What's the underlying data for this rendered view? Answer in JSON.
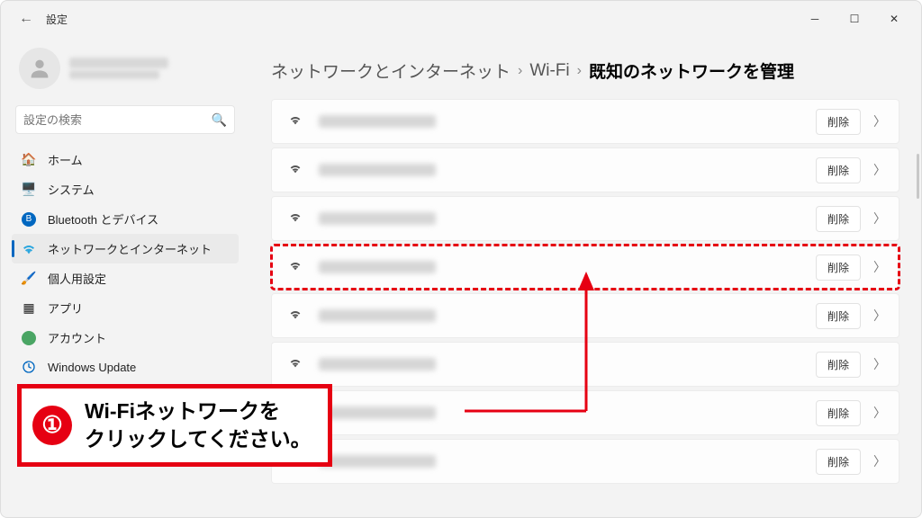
{
  "window": {
    "app_title": "設定",
    "back": "←"
  },
  "user": {
    "name_blur": true,
    "email_blur": true
  },
  "search": {
    "placeholder": "設定の検索"
  },
  "sidebar": {
    "items": [
      {
        "icon_color": "#c76b1e",
        "label": "ホーム",
        "name": "home"
      },
      {
        "icon_color": "#0067c0",
        "label": "システム",
        "name": "system"
      },
      {
        "icon_color": "#0067c0",
        "label": "Bluetooth とデバイス",
        "name": "bluetooth"
      },
      {
        "icon_color": "#0067c0",
        "label": "ネットワークとインターネット",
        "name": "network",
        "active": true
      },
      {
        "icon_color": "#b85c00",
        "label": "個人用設定",
        "name": "personalization"
      },
      {
        "icon_color": "#2b7cd3",
        "label": "アプリ",
        "name": "apps"
      },
      {
        "icon_color": "#4aa564",
        "label": "アカウント",
        "name": "account"
      },
      {
        "icon_color": "#888",
        "label": "",
        "name": "hidden1",
        "hidden_by_callout": true
      },
      {
        "icon_color": "#888",
        "label": "",
        "name": "hidden2",
        "hidden_by_callout": true
      },
      {
        "icon_color": "#888",
        "label": "",
        "name": "hidden3",
        "hidden_by_callout": true
      },
      {
        "icon_color": "#0067c0",
        "label": "Windows Update",
        "name": "windows-update"
      }
    ]
  },
  "breadcrumb": {
    "part1": "ネットワークとインターネット",
    "part2": "Wi-Fi",
    "part3": "既知のネットワークを管理",
    "sep": "›"
  },
  "networks": {
    "delete_label": "削除",
    "rows": [
      {
        "ssid_blur": true
      },
      {
        "ssid_blur": true
      },
      {
        "ssid_blur": true
      },
      {
        "ssid_blur": true,
        "highlight": true
      },
      {
        "ssid_blur": true
      },
      {
        "ssid_blur": true
      },
      {
        "ssid_blur": true
      },
      {
        "ssid_blur": true
      }
    ]
  },
  "callout": {
    "number": "①",
    "text": "Wi-Fiネットワークを\nクリックしてください。"
  },
  "colors": {
    "accent_red": "#e60012",
    "win_blue": "#0067c0"
  }
}
